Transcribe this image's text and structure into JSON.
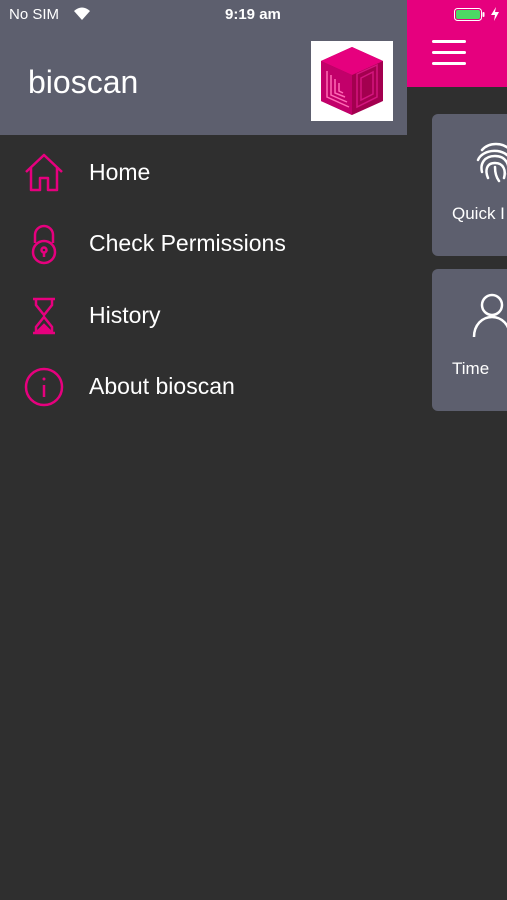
{
  "status_bar": {
    "carrier": "No SIM",
    "time": "9:19 am"
  },
  "drawer": {
    "title": "bioscan",
    "items": [
      {
        "label": "Home",
        "icon": "home-icon"
      },
      {
        "label": "Check Permissions",
        "icon": "padlock-icon"
      },
      {
        "label": "History",
        "icon": "hourglass-icon"
      },
      {
        "label": "About bioscan",
        "icon": "info-icon"
      }
    ]
  },
  "main": {
    "cards": [
      {
        "label": "Quick I",
        "icon": "fingerprint-icon"
      },
      {
        "label": "Time",
        "icon": "user-icon"
      }
    ]
  },
  "colors": {
    "accent": "#e6007e",
    "header_bg": "#5d5f6e",
    "drawer_bg": "#2f2f2f"
  }
}
